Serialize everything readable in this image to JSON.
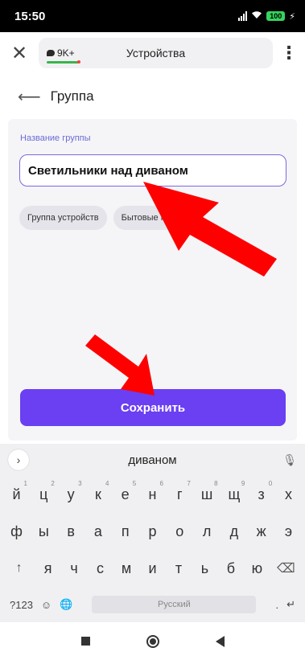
{
  "status_bar": {
    "time": "15:50",
    "battery": "100"
  },
  "browser": {
    "notifications": "9K+",
    "page_title": "Устройства"
  },
  "header": {
    "title": "Группа"
  },
  "form": {
    "field_label": "Название группы",
    "group_name": "Светильники над диваном",
    "chips": [
      "Группа устройств",
      "Бытовые приборы"
    ],
    "save_label": "Сохранить"
  },
  "keyboard": {
    "suggestion": "диваном",
    "row1": [
      "й",
      "ц",
      "у",
      "к",
      "е",
      "н",
      "г",
      "ш",
      "щ",
      "з",
      "х"
    ],
    "row1_hints": [
      "1",
      "2",
      "3",
      "4",
      "5",
      "6",
      "7",
      "8",
      "9",
      "0",
      ""
    ],
    "row2": [
      "ф",
      "ы",
      "в",
      "а",
      "п",
      "р",
      "о",
      "л",
      "д",
      "ж",
      "э"
    ],
    "row3": [
      "я",
      "ч",
      "с",
      "м",
      "и",
      "т",
      "ь",
      "б",
      "ю"
    ],
    "numbers_label": "?123",
    "space_label": "Русский",
    "period": "."
  },
  "colors": {
    "accent": "#6b3ff2",
    "input_border": "#7b68e3",
    "annotation_arrow": "#ff0000"
  }
}
